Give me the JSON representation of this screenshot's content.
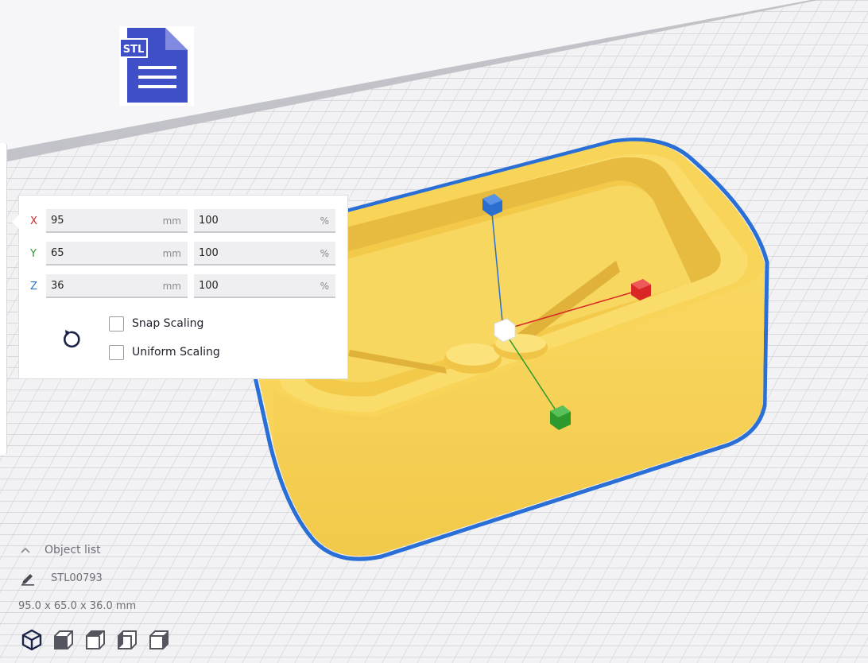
{
  "file_icon": {
    "badge": "STL"
  },
  "scale_panel": {
    "rows": [
      {
        "axis": "X",
        "axis_color": "#d92626",
        "size": "95",
        "size_unit": "mm",
        "percent": "100",
        "percent_unit": "%"
      },
      {
        "axis": "Y",
        "axis_color": "#2e9a2e",
        "size": "65",
        "size_unit": "mm",
        "percent": "100",
        "percent_unit": "%"
      },
      {
        "axis": "Z",
        "axis_color": "#2a6fcf",
        "size": "36",
        "size_unit": "mm",
        "percent": "100",
        "percent_unit": "%"
      }
    ],
    "snap_scaling_label": "Snap Scaling",
    "snap_scaling_checked": false,
    "uniform_scaling_label": "Uniform Scaling",
    "uniform_scaling_checked": false,
    "reset_icon": "reset-icon"
  },
  "object_list": {
    "header": "Object list",
    "object_name": "STL00793",
    "dimensions": "95.0 x 65.0 x 36.0 mm"
  },
  "view_buttons": [
    "3d-view-icon",
    "front-view-icon",
    "top-view-icon",
    "left-view-icon",
    "right-view-icon"
  ],
  "colors": {
    "model_yellow": "#f9d55a",
    "model_outline": "#2a6fd6",
    "axis_x": "#d92626",
    "axis_y": "#2e9a2e",
    "axis_z": "#2a6fcf",
    "stl_icon": "#3f4fc8"
  }
}
